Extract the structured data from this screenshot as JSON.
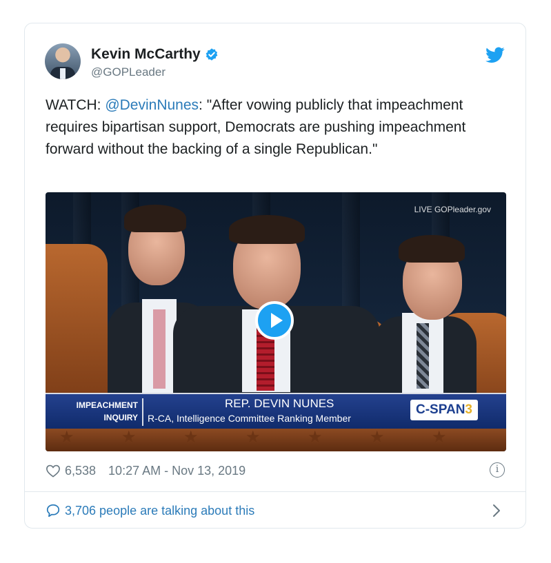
{
  "tweet": {
    "author": {
      "name": "Kevin McCarthy",
      "handle": "@GOPLeader"
    },
    "text_prefix": "WATCH: ",
    "mention": "@DevinNunes",
    "text_body": ": \"After vowing publicly that impeachment requires bipartisan support, Democrats are pushing impeachment forward without the backing of a single Republican.\"",
    "likes": "6,538",
    "timestamp": "10:27 AM - Nov 13, 2019",
    "talking": "3,706 people are talking about this"
  },
  "video": {
    "watermark": "GOPleader.gov",
    "live_label": "LIVE",
    "chyron_tag_line1": "IMPEACHMENT",
    "chyron_tag_line2": "INQUIRY",
    "chyron_name": "REP. DEVIN NUNES",
    "chyron_subtitle": "R-CA, Intelligence Committee Ranking Member",
    "network_main": "C-SPAN",
    "network_num": "3"
  },
  "colors": {
    "link": "#2b7bb9",
    "brand": "#1da1f2",
    "muted": "#697882"
  },
  "icons": [
    "verified-badge-icon",
    "twitter-bird-icon",
    "heart-icon",
    "info-icon",
    "speech-bubble-icon",
    "chevron-right-icon",
    "play-icon"
  ]
}
